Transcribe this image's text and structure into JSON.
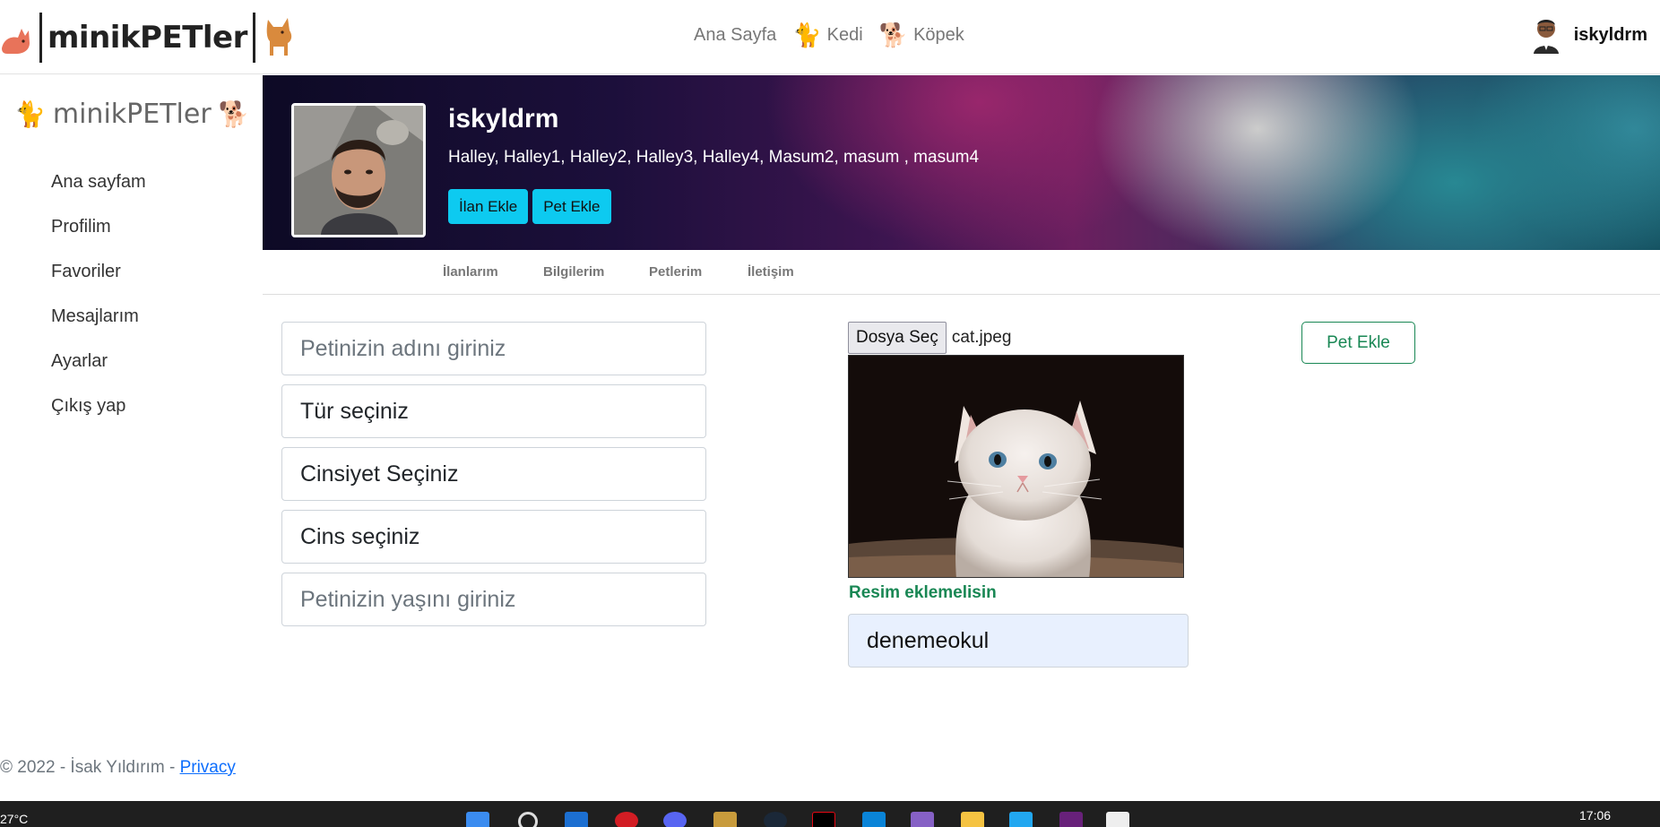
{
  "navbar": {
    "brand": "minikPETler",
    "links": [
      {
        "label": "Ana Sayfa",
        "icon": ""
      },
      {
        "label": "Kedi",
        "icon": "🐈"
      },
      {
        "label": "Köpek",
        "icon": "🐕"
      }
    ],
    "user": "iskyldrm"
  },
  "sidebar": {
    "brand": "minikPETler",
    "items": [
      {
        "label": "Ana sayfam"
      },
      {
        "label": "Profilim"
      },
      {
        "label": "Favoriler"
      },
      {
        "label": "Mesajlarım"
      },
      {
        "label": "Ayarlar"
      },
      {
        "label": "Çıkış yap"
      }
    ]
  },
  "profile": {
    "username": "iskyldrm",
    "pets": "Halley, Halley1, Halley2, Halley3, Halley4, Masum2, masum , masum4",
    "add_listing_label": "İlan Ekle",
    "add_pet_label": "Pet Ekle"
  },
  "tabs": [
    {
      "label": "İlanlarım"
    },
    {
      "label": "Bilgilerim"
    },
    {
      "label": "Petlerim"
    },
    {
      "label": "İletişim"
    }
  ],
  "form": {
    "pet_name_placeholder": "Petinizin adını giriniz",
    "type_select": "Tür seçiniz",
    "gender_select": "Cinsiyet Seçiniz",
    "breed_select": "Cins seçiniz",
    "age_placeholder": "Petinizin yaşını giriniz",
    "file_button": "Dosya Seç",
    "file_name": "cat.jpeg",
    "image_validation": "Resim eklemelisin",
    "name_value": "denemeokul",
    "submit_label": "Pet Ekle"
  },
  "footer": {
    "text": "© 2022 - İsak Yıldırım - ",
    "privacy": "Privacy"
  },
  "taskbar": {
    "temperature": "27°C",
    "time": "17:06"
  },
  "colors": {
    "info": "#0dcaf0",
    "success": "#198754",
    "link": "#0d6efd",
    "autofill": "#e8f0fe"
  }
}
